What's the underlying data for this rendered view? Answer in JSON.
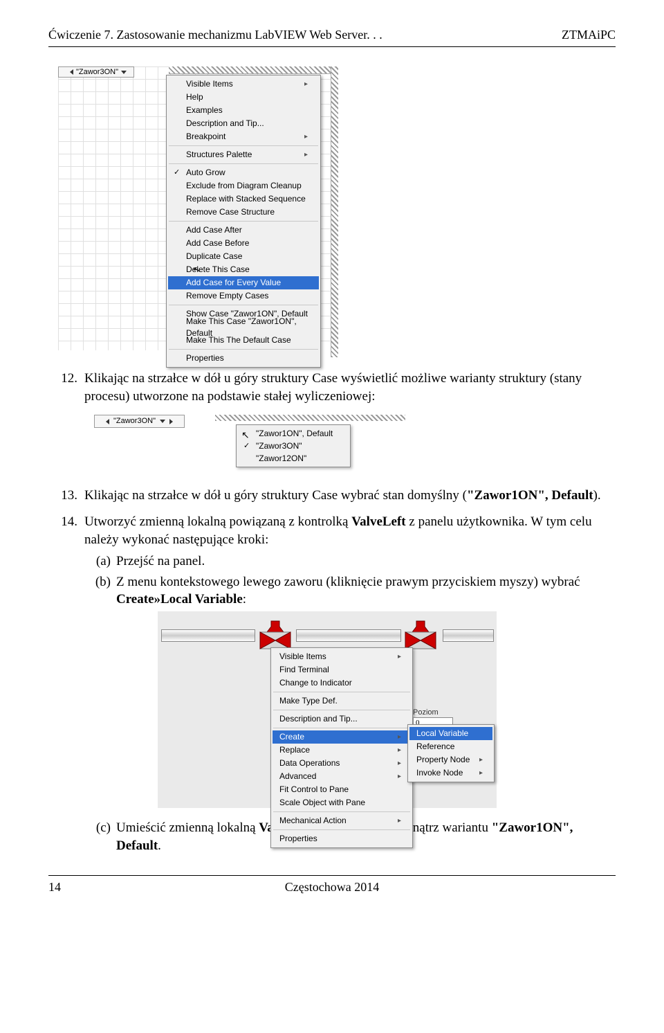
{
  "header": {
    "left": "Ćwiczenie 7. Zastosowanie mechanizmu LabVIEW Web Server. . .",
    "right": "ZTMAiPC"
  },
  "footer": {
    "page": "14",
    "center": "Częstochowa 2014"
  },
  "img1": {
    "case_label": "\"Zawor3ON\"",
    "menu": {
      "g1": [
        {
          "label": "Visible Items",
          "sub": true
        },
        {
          "label": "Help"
        },
        {
          "label": "Examples"
        },
        {
          "label": "Description and Tip..."
        },
        {
          "label": "Breakpoint",
          "sub": true
        }
      ],
      "g2": [
        {
          "label": "Structures Palette",
          "sub": true
        }
      ],
      "g3": [
        {
          "label": "Auto Grow",
          "chk": true
        },
        {
          "label": "Exclude from Diagram Cleanup"
        },
        {
          "label": "Replace with Stacked Sequence"
        },
        {
          "label": "Remove Case Structure"
        }
      ],
      "g4": [
        {
          "label": "Add Case After"
        },
        {
          "label": "Add Case Before"
        },
        {
          "label": "Duplicate Case"
        },
        {
          "label": "Delete This Case"
        },
        {
          "label": "Add Case for Every Value",
          "hi": true
        },
        {
          "label": "Remove Empty Cases"
        }
      ],
      "g5": [
        {
          "label": "Show Case \"Zawor1ON\", Default"
        },
        {
          "label": "Make This Case \"Zawor1ON\", Default"
        },
        {
          "label": "Make This The Default Case"
        }
      ],
      "g6": [
        {
          "label": "Properties"
        }
      ]
    }
  },
  "items": {
    "n12": "12.",
    "t12": "Klikając na strzałce w dół u góry struktury Case wyświetlić możliwe warianty struktury (stany procesu) utworzone na podstawie stałej wyliczeniowej:",
    "n13": "13.",
    "t13_a": "Klikając na strzałce w dół u góry struktury Case wybrać stan domyślny (",
    "t13_b": "\"Zawor1ON\", Default",
    "t13_c": ").",
    "n14": "14.",
    "t14_a": "Utworzyć zmienną lokalną powiązaną z kontrolką ",
    "t14_b": "ValveLeft",
    "t14_c": " z panelu użytkownika. W tym celu należy wykonać następujące kroki:",
    "sa": "(a)",
    "ta": "Przejść na panel.",
    "sb": "(b)",
    "tb_a": "Z menu kontekstowego lewego zaworu (kliknięcie prawym przyciskiem myszy) wybrać ",
    "tb_b": "Create»Local Variable",
    "tb_c": ":",
    "sc": "(c)",
    "tc_a": "Umieścić zmienną lokalną ",
    "tc_b": "ValveLeft",
    "tc_c": " na diagramie wewnątrz wariantu ",
    "tc_d": "\"Zawor1ON\", Default",
    "tc_e": "."
  },
  "img2": {
    "sel_label": "\"Zawor3ON\"",
    "rows": [
      "\"Zawor1ON\", Default",
      "\"Zawor3ON\"",
      "\"Zawor12ON\""
    ],
    "checked_index": 1
  },
  "img3": {
    "poziom_label": "Poziom",
    "poziom_value": "0",
    "menu": [
      {
        "label": "Visible Items",
        "sub": true
      },
      {
        "label": "Find Terminal"
      },
      {
        "label": "Change to Indicator"
      },
      "sep",
      {
        "label": "Make Type Def."
      },
      "sep",
      {
        "label": "Description and Tip..."
      },
      "sep",
      {
        "label": "Create",
        "sub": true,
        "hi": true
      },
      {
        "label": "Replace",
        "sub": true
      },
      {
        "label": "Data Operations",
        "sub": true
      },
      {
        "label": "Advanced",
        "sub": true
      },
      {
        "label": "Fit Control to Pane"
      },
      {
        "label": "Scale Object with Pane"
      },
      "sep",
      {
        "label": "Mechanical Action",
        "sub": true
      },
      "sep",
      {
        "label": "Properties"
      }
    ],
    "submenu": [
      {
        "label": "Local Variable",
        "hi": true
      },
      {
        "label": "Reference"
      },
      {
        "label": "Property Node",
        "sub": true
      },
      {
        "label": "Invoke Node",
        "sub": true
      }
    ]
  }
}
